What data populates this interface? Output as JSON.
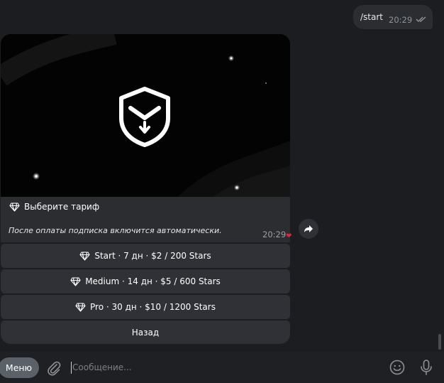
{
  "outgoing": {
    "text": "/start",
    "time": "20:29"
  },
  "incoming": {
    "title": "Выберите тариф",
    "subtitle": "После оплаты подписка включится автоматически.",
    "time": "20:29",
    "reaction": "❤"
  },
  "keyboard": [
    {
      "label": "Start · 7 дн · $2 / 200 Stars",
      "icon": "diamond-icon"
    },
    {
      "label": "Medium · 14 дн · $5 / 600 Stars",
      "icon": "diamond-icon"
    },
    {
      "label": "Pro · 30 дн · $10 / 1200 Stars",
      "icon": "diamond-icon"
    },
    {
      "label": "Назад"
    }
  ],
  "composer": {
    "menu_label": "Меню",
    "placeholder": "Сообщение..."
  },
  "colors": {
    "background": "#1c1d20",
    "bubble": "#2b2d31",
    "button": "#2f3136",
    "menu_button": "#5a6169",
    "heart": "#e0263d"
  }
}
